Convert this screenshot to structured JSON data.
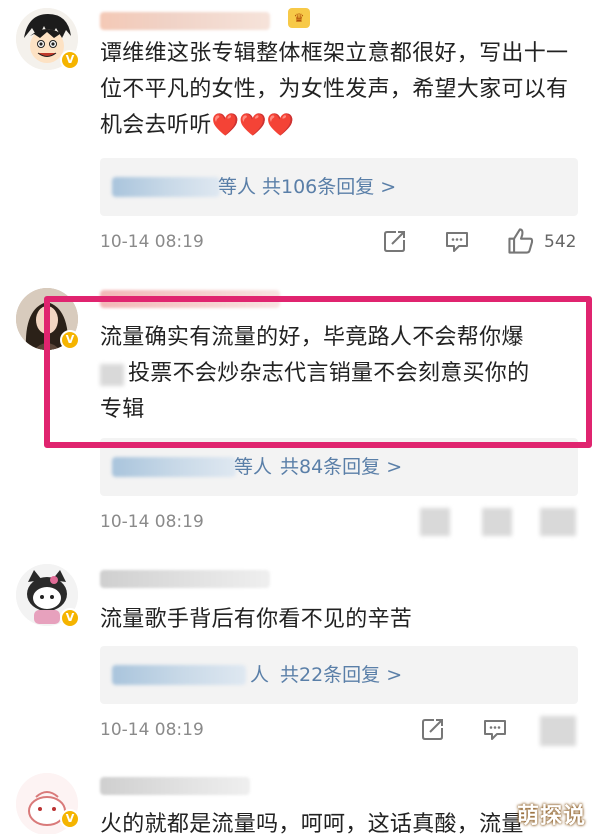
{
  "comments": [
    {
      "text": "谭维维这张专辑整体框架立意都很好，写出十一位不平凡的女性，为女性发声，希望大家可以有机会去听听❤️❤️❤️",
      "reply_suffix": "等人",
      "reply_count": "共106条回复 >",
      "timestamp": "10-14 08:19",
      "likes": "542"
    },
    {
      "text": "流量确实有流量的好，毕竟路人不会帮你爆",
      "text_line2": "投票不会炒杂志代言销量不会刻意买你的",
      "text_line3": "专辑",
      "reply_suffix": "等人",
      "reply_count": "共84条回复 >",
      "timestamp": "10-14 08:19"
    },
    {
      "text": "流量歌手背后有你看不见的辛苦",
      "reply_suffix": "人",
      "reply_count": "共22条回复 >",
      "timestamp": "10-14 08:19"
    },
    {
      "text": "火的就都是流量吗，呵呵，这话真酸，流量"
    }
  ],
  "icons": {
    "forward": "share-icon",
    "comment": "comment-icon",
    "like": "thumbs-up-icon"
  },
  "colors": {
    "highlight": "#e0246f",
    "verify": "#f5b400",
    "reply_link": "#5a7fa8"
  },
  "watermark": "萌探说"
}
